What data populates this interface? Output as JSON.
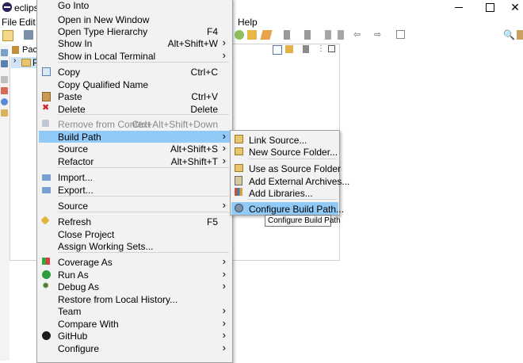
{
  "window": {
    "title": "eclipse-w",
    "close_glyph": "✕"
  },
  "menubar": {
    "file": "File",
    "edit": "Edit",
    "help": "Help"
  },
  "view": {
    "tab_label": "Pack",
    "tree_item": "Pr",
    "tree_chevron": "›"
  },
  "context_menu": {
    "items": [
      {
        "label": "Go Into",
        "accel": "",
        "icon": "none"
      },
      {
        "label": "Open in New Window",
        "accel": "",
        "icon": "none"
      },
      {
        "label": "Open Type Hierarchy",
        "accel": "F4",
        "icon": "none"
      },
      {
        "label": "Show In",
        "accel": "Alt+Shift+W",
        "icon": "none",
        "submenu": true
      },
      {
        "label": "Show in Local Terminal",
        "accel": "",
        "icon": "none",
        "submenu": true
      },
      {
        "label": "Copy",
        "accel": "Ctrl+C",
        "icon": "copy-icon"
      },
      {
        "label": "Copy Qualified Name",
        "accel": "",
        "icon": "none"
      },
      {
        "label": "Paste",
        "accel": "Ctrl+V",
        "icon": "paste-icon"
      },
      {
        "label": "Delete",
        "accel": "Delete",
        "icon": "delete-icon"
      },
      {
        "label": "Remove from Context",
        "accel": "Ctrl+Alt+Shift+Down",
        "icon": "remove-context-icon",
        "disabled": true
      },
      {
        "label": "Build Path",
        "accel": "",
        "icon": "none",
        "submenu": true,
        "highlight": true
      },
      {
        "label": "Source",
        "accel": "Alt+Shift+S",
        "icon": "none",
        "submenu": true
      },
      {
        "label": "Refactor",
        "accel": "Alt+Shift+T",
        "icon": "none",
        "submenu": true
      },
      {
        "label": "Import...",
        "accel": "",
        "icon": "import-icon"
      },
      {
        "label": "Export...",
        "accel": "",
        "icon": "export-icon"
      },
      {
        "label": "Source",
        "accel": "",
        "icon": "none",
        "submenu": true
      },
      {
        "label": "Refresh",
        "accel": "F5",
        "icon": "refresh-icon"
      },
      {
        "label": "Close Project",
        "accel": "",
        "icon": "none"
      },
      {
        "label": "Assign Working Sets...",
        "accel": "",
        "icon": "none"
      },
      {
        "label": "Coverage As",
        "accel": "",
        "icon": "coverage-icon",
        "submenu": true
      },
      {
        "label": "Run As",
        "accel": "",
        "icon": "run-icon",
        "submenu": true
      },
      {
        "label": "Debug As",
        "accel": "",
        "icon": "debug-icon",
        "submenu": true
      },
      {
        "label": "Restore from Local History...",
        "accel": "",
        "icon": "none"
      },
      {
        "label": "Team",
        "accel": "",
        "icon": "none",
        "submenu": true
      },
      {
        "label": "Compare With",
        "accel": "",
        "icon": "none",
        "submenu": true
      },
      {
        "label": "GitHub",
        "accel": "",
        "icon": "github-icon",
        "submenu": true
      },
      {
        "label": "Configure",
        "accel": "",
        "icon": "none",
        "submenu": true
      }
    ]
  },
  "build_path_menu": {
    "items": [
      {
        "label": "Link Source...",
        "icon": "link-source-icon"
      },
      {
        "label": "New Source Folder...",
        "icon": "new-source-folder-icon"
      },
      {
        "label": "Use as Source Folder",
        "icon": "use-source-folder-icon"
      },
      {
        "label": "Add External Archives...",
        "icon": "add-archive-icon"
      },
      {
        "label": "Add Libraries...",
        "icon": "add-libraries-icon"
      },
      {
        "label": "Configure Build Path...",
        "icon": "configure-build-path-icon",
        "highlight": true
      }
    ]
  },
  "tooltip": {
    "text": "Configure Build Path"
  },
  "colors": {
    "highlight": "#91c9f7",
    "menu_bg": "#f2f2f2",
    "disabled_text": "#8a8a8a"
  }
}
